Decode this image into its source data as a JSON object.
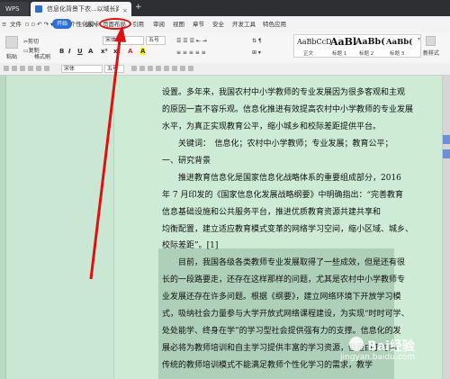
{
  "titlebar": {
    "app_tab": "WPS",
    "doc_tab": "信息化背景下农...以域长路径探析",
    "close": "×",
    "new_tab": "+"
  },
  "menubar": {
    "file": "文件",
    "start": "开始",
    "items": [
      "个性化模卡",
      "插入",
      "页面布局",
      "引用",
      "审阅",
      "视图",
      "章节",
      "安全",
      "开发工具",
      "特色应用"
    ]
  },
  "ribbon": {
    "paste": "粘贴",
    "cut": "剪切",
    "copy": "复制",
    "format_painter": "格式刷",
    "font_name": "宋体",
    "font_size": "五号",
    "style_font": "段落",
    "styles": [
      {
        "sample": "AaBbCcD",
        "label": "正文"
      },
      {
        "sample": "AaBl",
        "label": "标题 1"
      },
      {
        "sample": "AaBb(",
        "label": "标题 2"
      },
      {
        "sample": "AaBb(",
        "label": "标题 3"
      }
    ],
    "new_style": "新样式",
    "text_tools": "文字工具"
  },
  "document": {
    "lines": [
      "设置。多年来，我国农村中小学教师的专业发展因为很多客观和主观",
      "的原因一直不容乐观。信息化推进有效提高农村中小学教师的专业发展",
      "水平，为真正实现教育公平，缩小城乡和校际差距提供平台。",
      "关键词：　信息化；农村中小学教师；专业发展；教育公平；",
      "一、研究背景",
      "推进教育信息化是国家信息化战略体系的重要组成部分，2016",
      "年 7 月印发的《国家信息化发展战略纲要》中明确指出：“完善教育",
      "信息基础设施和公共服务平台，推进优质教育资源共建共享和",
      "均衡配置，建立适应教育模式变革的网络学习空间，缩小区域、城乡、",
      "校际差距”。[1]",
      "目前，我国各级各类教师专业发展取得了一些成效，但是还有很",
      "长的一段路要走，还存在这样那样的问题，尤其是农村中小学教师专",
      "业发展还存在许多问题。根据《纲要》，建立网络环境下开放学习模",
      "式，吸纳社会力量参与大学开放式网络课程建设，为实现“时时可学、",
      "处处能学、终身在学”的学习型社会提供强有力的支撑。信息化的发",
      "展必将为教师培训和自主学习提供丰富的学习资源，但是由于时间",
      "传统的教师培训模式不能满足教师个性化学习的需求，教学"
    ]
  },
  "watermark": {
    "text": "Bai经验",
    "url": "jingyan.baidu.com"
  }
}
